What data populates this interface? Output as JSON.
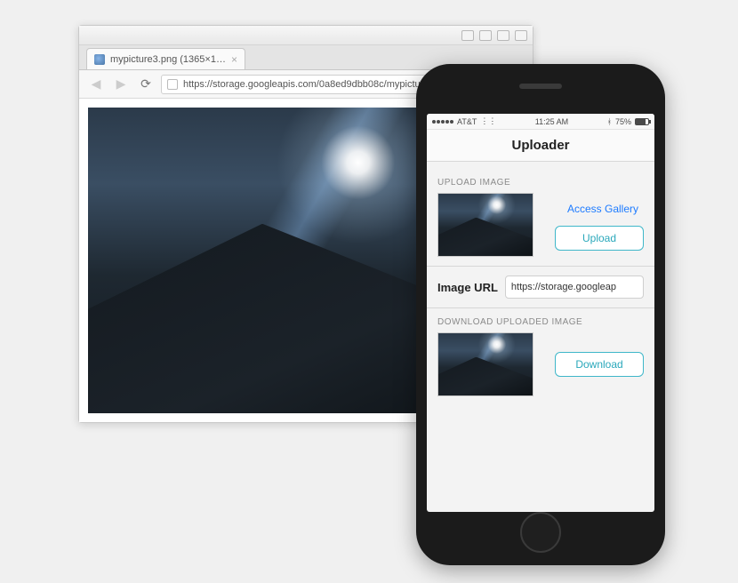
{
  "browser": {
    "tab": {
      "title": "mypicture3.png (1365×1…"
    },
    "address_url": "https://storage.googleapis.com/0a8ed9dbb08c/mypicture3.png"
  },
  "phone": {
    "status": {
      "carrier": "AT&T",
      "time": "11:25 AM",
      "battery_pct": "75%"
    },
    "nav_title": "Uploader",
    "upload": {
      "section_label": "UPLOAD IMAGE",
      "access_gallery": "Access Gallery",
      "upload_btn": "Upload"
    },
    "image_url": {
      "label": "Image URL",
      "value": "https://storage.googleap"
    },
    "download": {
      "section_label": "DOWNLOAD UPLOADED IMAGE",
      "download_btn": "Download"
    }
  }
}
